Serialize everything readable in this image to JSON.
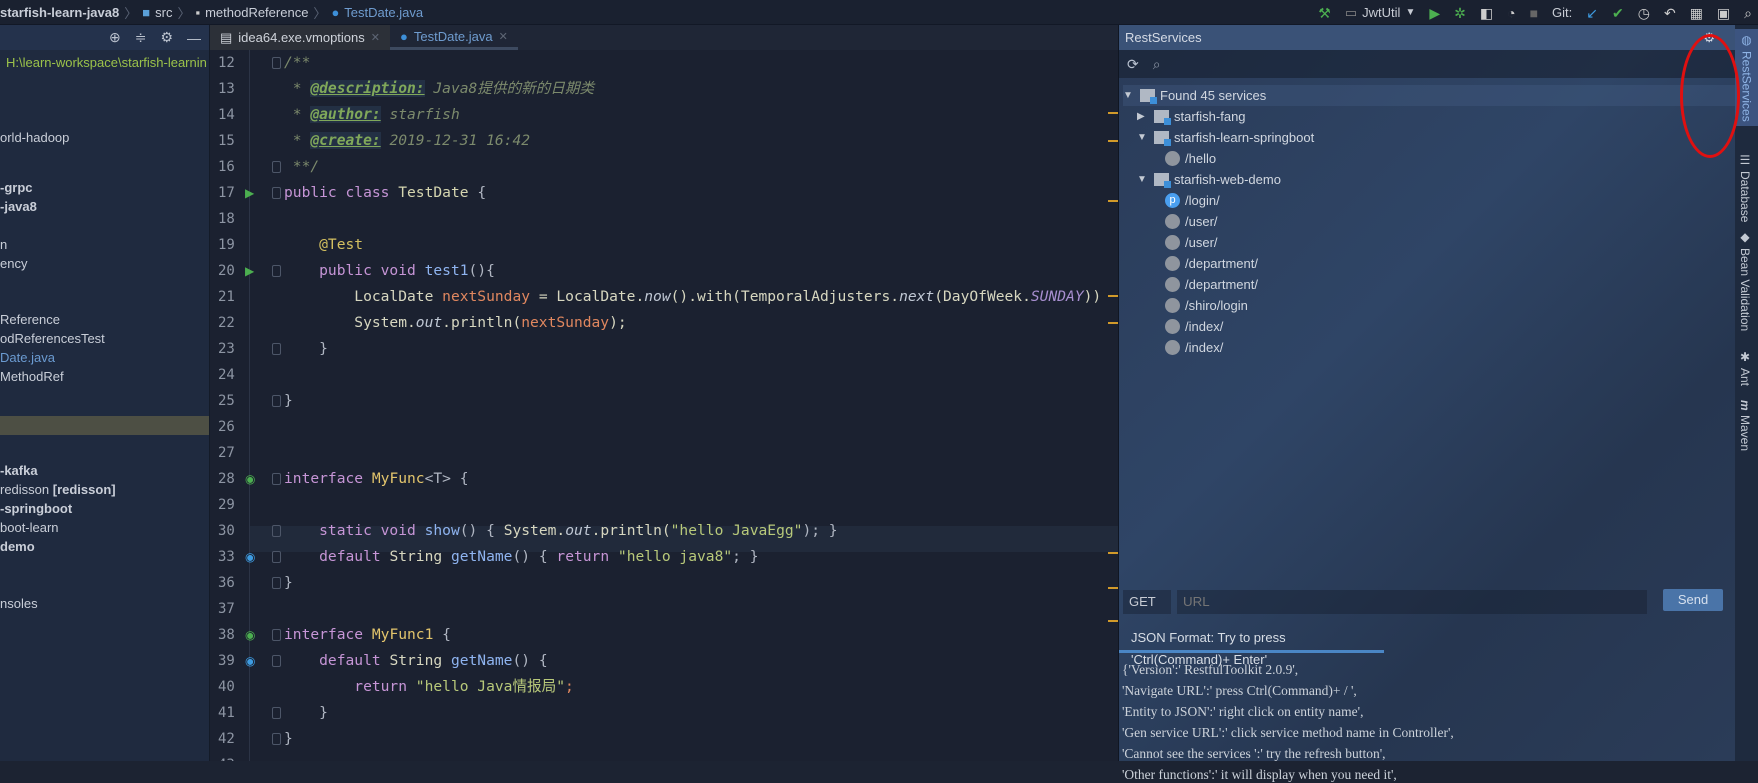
{
  "breadcrumb": {
    "project": "starfish-learn-java8",
    "items": [
      "src",
      "methodReference",
      "TestDate.java"
    ]
  },
  "toolbar": {
    "run_config": "JwtUtil",
    "git_label": "Git:"
  },
  "left_panel": {
    "path": "H:\\learn-workspace\\starfish-learnin",
    "items": [
      {
        "text": "orld-hadoop",
        "bold": false
      },
      {
        "text": "-grpc",
        "bold": true
      },
      {
        "text": "-java8",
        "bold": true
      },
      {
        "text": "n",
        "bold": false
      },
      {
        "text": "ency",
        "bold": false
      },
      {
        "text": "Reference",
        "bold": false
      },
      {
        "text": "odReferencesTest",
        "bold": false
      },
      {
        "text": "Date.java",
        "bold": false,
        "color": "#6b9bd1"
      },
      {
        "text": "MethodRef",
        "bold": false
      },
      {
        "text": "-kafka",
        "bold": true
      },
      {
        "text": "redisson ",
        "bold": false,
        "suffix": "[redisson]"
      },
      {
        "text": "-springboot",
        "bold": true
      },
      {
        "text": "boot-learn",
        "bold": false
      },
      {
        "text": "demo",
        "bold": true
      },
      {
        "text": "nsoles",
        "bold": false
      }
    ]
  },
  "tabs": [
    {
      "label": "idea64.exe.vmoptions",
      "active": false
    },
    {
      "label": "TestDate.java",
      "active": true
    }
  ],
  "code": [
    {
      "n": "12",
      "fold": true,
      "t": [
        [
          "cm",
          "/**"
        ]
      ]
    },
    {
      "n": "13",
      "t": [
        [
          "cm",
          " * "
        ],
        [
          "tag",
          "@description:"
        ],
        [
          "cm",
          " Java8提供的新的日期类"
        ]
      ]
    },
    {
      "n": "14",
      "t": [
        [
          "cm",
          " * "
        ],
        [
          "tag",
          "@author:"
        ],
        [
          "cm",
          " starfish"
        ]
      ]
    },
    {
      "n": "15",
      "t": [
        [
          "cm",
          " * "
        ],
        [
          "tag",
          "@create:"
        ],
        [
          "cm",
          " 2019-12-31 16:42"
        ]
      ]
    },
    {
      "n": "16",
      "fold": true,
      "t": [
        [
          "cm",
          " **/"
        ]
      ]
    },
    {
      "n": "17",
      "g": "run",
      "fold": true,
      "t": [
        [
          "kw",
          "public class "
        ],
        [
          "cn",
          "TestDate"
        ],
        [
          "sym",
          " {"
        ]
      ]
    },
    {
      "n": "18",
      "t": []
    },
    {
      "n": "19",
      "t": [
        [
          "ann",
          "    @Test"
        ]
      ]
    },
    {
      "n": "20",
      "g": "run",
      "fold": true,
      "t": [
        [
          "kw",
          "    public void "
        ],
        [
          "fn",
          "test1"
        ],
        [
          "sym",
          "(){"
        ]
      ]
    },
    {
      "n": "21",
      "t": [
        [
          "pl",
          "        LocalDate "
        ],
        [
          "var",
          "nextSunday"
        ],
        [
          "pl",
          " = LocalDate."
        ],
        [
          "it",
          "now"
        ],
        [
          "pl",
          "().with(TemporalAdjusters."
        ],
        [
          "it",
          "next"
        ],
        [
          "pl",
          "(DayOfWeek."
        ],
        [
          "cst",
          "SUNDAY"
        ],
        [
          "pl",
          "))"
        ]
      ]
    },
    {
      "n": "22",
      "t": [
        [
          "pl",
          "        System."
        ],
        [
          "it",
          "out"
        ],
        [
          "pl",
          ".println("
        ],
        [
          "var",
          "nextSunday"
        ],
        [
          "pl",
          ");"
        ]
      ]
    },
    {
      "n": "23",
      "fold": true,
      "t": [
        [
          "sym",
          "    }"
        ]
      ]
    },
    {
      "n": "24",
      "t": []
    },
    {
      "n": "25",
      "fold": true,
      "t": [
        [
          "sym",
          "}"
        ]
      ]
    },
    {
      "n": "26",
      "t": []
    },
    {
      "n": "27",
      "t": []
    },
    {
      "n": "28",
      "g": "impl",
      "fold": true,
      "t": [
        [
          "kw",
          "interface "
        ],
        [
          "cls",
          "MyFunc"
        ],
        [
          "sym",
          "<T> {"
        ]
      ]
    },
    {
      "n": "29",
      "t": []
    },
    {
      "n": "30",
      "fold": true,
      "t": [
        [
          "kw",
          "    static void "
        ],
        [
          "fn",
          "show"
        ],
        [
          "sym",
          "() { "
        ],
        [
          "pl",
          "System."
        ],
        [
          "it",
          "out"
        ],
        [
          "pl",
          ".println("
        ],
        [
          "str",
          "\"hello JavaEgg\""
        ],
        [
          "sym",
          "); }"
        ]
      ]
    },
    {
      "n": "33",
      "g": "impl2",
      "fold": true,
      "t": [
        [
          "kw",
          "    default "
        ],
        [
          "pl",
          "String "
        ],
        [
          "fn",
          "getName"
        ],
        [
          "sym",
          "() { "
        ],
        [
          "kw",
          "return "
        ],
        [
          "str",
          "\"hello java8\""
        ],
        [
          "sym",
          "; }"
        ]
      ]
    },
    {
      "n": "36",
      "fold": true,
      "t": [
        [
          "sym",
          "}"
        ]
      ]
    },
    {
      "n": "37",
      "t": []
    },
    {
      "n": "38",
      "g": "impl",
      "fold": true,
      "t": [
        [
          "kw",
          "interface "
        ],
        [
          "cls",
          "MyFunc1"
        ],
        [
          "sym",
          " {"
        ]
      ]
    },
    {
      "n": "39",
      "g": "impl2",
      "fold": true,
      "t": [
        [
          "kw",
          "    default "
        ],
        [
          "pl",
          "String "
        ],
        [
          "fn",
          "getName"
        ],
        [
          "sym",
          "() {"
        ]
      ]
    },
    {
      "n": "40",
      "t": [
        [
          "kw",
          "        return "
        ],
        [
          "str",
          "\"hello Java情报局\""
        ],
        [
          "var",
          ";"
        ]
      ]
    },
    {
      "n": "41",
      "fold": true,
      "t": [
        [
          "sym",
          "    }"
        ]
      ]
    },
    {
      "n": "42",
      "fold": true,
      "t": [
        [
          "sym",
          "}"
        ]
      ]
    },
    {
      "n": "43",
      "t": []
    }
  ],
  "rest_services": {
    "title": "RestServices",
    "root": "Found 45 services",
    "tree": [
      {
        "label": "starfish-fang",
        "level": 1,
        "type": "module",
        "expanded": false
      },
      {
        "label": "starfish-learn-springboot",
        "level": 1,
        "type": "module",
        "expanded": true
      },
      {
        "label": "/hello",
        "level": 2,
        "type": "service"
      },
      {
        "label": "starfish-web-demo",
        "level": 1,
        "type": "module",
        "expanded": true
      },
      {
        "label": "/login/",
        "level": 2,
        "type": "service",
        "badge": "p"
      },
      {
        "label": "/user/",
        "level": 2,
        "type": "service"
      },
      {
        "label": "/user/",
        "level": 2,
        "type": "service"
      },
      {
        "label": "/department/",
        "level": 2,
        "type": "service"
      },
      {
        "label": "/department/",
        "level": 2,
        "type": "service"
      },
      {
        "label": "/shiro/login",
        "level": 2,
        "type": "service"
      },
      {
        "label": "/index/",
        "level": 2,
        "type": "service"
      },
      {
        "label": "/index/",
        "level": 2,
        "type": "service"
      }
    ],
    "method": "GET",
    "url_placeholder": "URL",
    "send_label": "Send",
    "json_tab": "JSON Format: Try to press 'Ctrl(Command)+ Enter'",
    "json_lines": [
      "{'Version':' RestfulToolkit 2.0.9',",
      "'Navigate URL':' press Ctrl(Command)+ / ',",
      "'Entity to JSON':' right click on entity name',",
      "'Gen service URL':' click service method name in Controller',",
      "'Cannot see the services ':' try the refresh button',",
      "'Other functions':' it will display when you need it',"
    ]
  },
  "side_tools": [
    "RestServices",
    "Database",
    "Bean Validation",
    "Ant",
    "Maven"
  ]
}
